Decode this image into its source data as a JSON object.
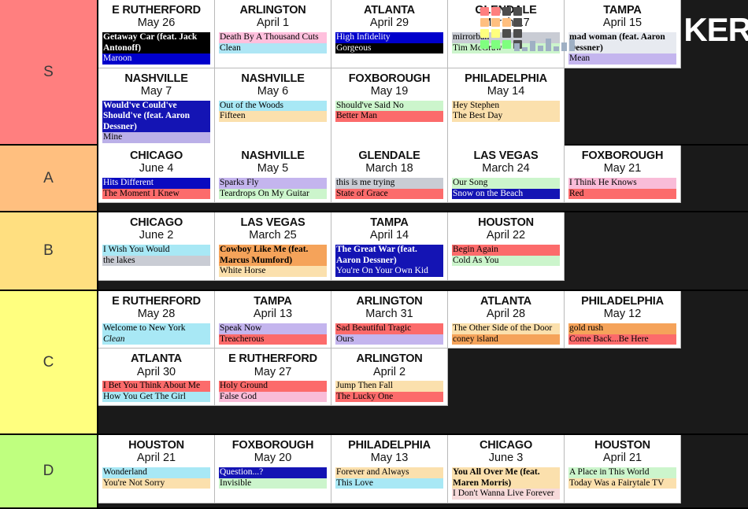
{
  "watermark": {
    "brand_text": "KER",
    "swatch_colors": [
      "#ff7f7f",
      "#ff7f7f",
      "#4d4d4d",
      "#4d4d4d",
      "#ffbf7f",
      "#ffbf7f",
      "#ffbf7f",
      "#4d4d4d",
      "#ffff7f",
      "#ffff7f",
      "#4d4d4d",
      "#4d4d4d",
      "#7fff7f",
      "#7fff7f",
      "#7fff7f",
      "#4d4d4d"
    ],
    "bar_heights": [
      10,
      5,
      13,
      7,
      16,
      6,
      11,
      15
    ]
  },
  "tiers": [
    {
      "label": "S",
      "color": "#ff7f7f",
      "cards": [
        {
          "city": "E RUTHERFORD",
          "date": "May 26",
          "songs": [
            {
              "text": "Getaway Car (feat. Jack Antonoff)",
              "bg": "#000000",
              "fg": "#ffffff",
              "bold": true
            },
            {
              "text": "Maroon",
              "bg": "#0000cc",
              "fg": "#ffffff",
              "bold": false
            }
          ]
        },
        {
          "city": "ARLINGTON",
          "date": "April 1",
          "songs": [
            {
              "text": "Death By A Thousand Cuts",
              "bg": "#ffc0dd",
              "fg": "#000000",
              "bold": false
            },
            {
              "text": "Clean",
              "bg": "#aee6f5",
              "fg": "#000000",
              "bold": false
            }
          ]
        },
        {
          "city": "ATLANTA",
          "date": "April 29",
          "songs": [
            {
              "text": "High Infidelity",
              "bg": "#0000cc",
              "fg": "#ffffff",
              "bold": false
            },
            {
              "text": "Gorgeous",
              "bg": "#000000",
              "fg": "#ffffff",
              "bold": false
            }
          ]
        },
        {
          "city": "GLENDALE",
          "date": "March 17",
          "songs": [
            {
              "text": "mirrorball",
              "bg": "#c9ccd4",
              "fg": "#000000",
              "bold": false
            },
            {
              "text": "Tim McGraw",
              "bg": "#ccf5cc",
              "fg": "#000000",
              "bold": false
            }
          ]
        },
        {
          "city": "TAMPA",
          "date": "April 15",
          "songs": [
            {
              "text": "mad woman (feat. Aaron Dessner)",
              "bg": "#e7eaf0",
              "fg": "#000000",
              "bold": true
            },
            {
              "text": "Mean",
              "bg": "#c4b5ee",
              "fg": "#000000",
              "bold": false
            }
          ]
        },
        {
          "city": "NASHVILLE",
          "date": "May 7",
          "songs": [
            {
              "text": "Would've Could've Should've (feat. Aaron Dessner)",
              "bg": "#1414b4",
              "fg": "#ffffff",
              "bold": true
            },
            {
              "text": "Mine",
              "bg": "#bbb0e8",
              "fg": "#000000",
              "bold": false
            }
          ]
        },
        {
          "city": "NASHVILLE",
          "date": "May 6",
          "songs": [
            {
              "text": "Out of the Woods",
              "bg": "#a8e8f5",
              "fg": "#000000",
              "bold": false
            },
            {
              "text": "Fifteen",
              "bg": "#fbe0ad",
              "fg": "#000000",
              "bold": false
            }
          ]
        },
        {
          "city": "FOXBOROUGH",
          "date": "May 19",
          "songs": [
            {
              "text": "Should've Said No",
              "bg": "#ccf5cc",
              "fg": "#000000",
              "bold": false
            },
            {
              "text": "Better Man",
              "bg": "#fc6b6b",
              "fg": "#000000",
              "bold": false
            }
          ]
        },
        {
          "city": "PHILADELPHIA",
          "date": "May 14",
          "songs": [
            {
              "text": "Hey Stephen",
              "bg": "#fbe0ad",
              "fg": "#000000",
              "bold": false
            },
            {
              "text": "The Best Day",
              "bg": "#fbe0ad",
              "fg": "#000000",
              "bold": false
            }
          ]
        }
      ]
    },
    {
      "label": "A",
      "color": "#ffbf7f",
      "cards": [
        {
          "city": "CHICAGO",
          "date": "June 4",
          "songs": [
            {
              "text": "Hits Different",
              "bg": "#0a0ac0",
              "fg": "#ffffff",
              "bold": false
            },
            {
              "text": "The Moment I Knew",
              "bg": "#fc6b6b",
              "fg": "#000000",
              "bold": false
            }
          ]
        },
        {
          "city": "NASHVILLE",
          "date": "May 5",
          "songs": [
            {
              "text": "Sparks Fly",
              "bg": "#c4b5ee",
              "fg": "#000000",
              "bold": false
            },
            {
              "text": "Teardrops On My Guitar",
              "bg": "#ccf5cc",
              "fg": "#000000",
              "bold": false
            }
          ]
        },
        {
          "city": "GLENDALE",
          "date": "March 18",
          "songs": [
            {
              "text": "this is me trying",
              "bg": "#c9ccd4",
              "fg": "#000000",
              "bold": false
            },
            {
              "text": "State of Grace",
              "bg": "#fc6b6b",
              "fg": "#000000",
              "bold": false
            }
          ]
        },
        {
          "city": "LAS VEGAS",
          "date": "March 24",
          "songs": [
            {
              "text": "Our Song",
              "bg": "#ccf5cc",
              "fg": "#000000",
              "bold": false
            },
            {
              "text": "Snow on the Beach",
              "bg": "#1414b4",
              "fg": "#ffffff",
              "bold": false
            }
          ]
        },
        {
          "city": "FOXBOROUGH",
          "date": "May 21",
          "songs": [
            {
              "text": "I Think He Knows",
              "bg": "#f9bcd8",
              "fg": "#000000",
              "bold": false
            },
            {
              "text": "Red",
              "bg": "#fc6b6b",
              "fg": "#000000",
              "bold": false
            }
          ]
        }
      ]
    },
    {
      "label": "B",
      "color": "#ffdf80",
      "cards": [
        {
          "city": "CHICAGO",
          "date": "June 2",
          "songs": [
            {
              "text": "I Wish You Would",
              "bg": "#a8e8f5",
              "fg": "#000000",
              "bold": false
            },
            {
              "text": "the lakes",
              "bg": "#c9ccd4",
              "fg": "#000000",
              "bold": false
            }
          ]
        },
        {
          "city": "LAS VEGAS",
          "date": "March 25",
          "songs": [
            {
              "text": "Cowboy Like Me (feat. Marcus Mumford)",
              "bg": "#f5a35a",
              "fg": "#000000",
              "bold": true
            },
            {
              "text": "White Horse",
              "bg": "#fbe0ad",
              "fg": "#000000",
              "bold": false
            }
          ]
        },
        {
          "city": "TAMPA",
          "date": "April 14",
          "songs": [
            {
              "text": "The Great War (feat. Aaron Dessner)",
              "bg": "#1414b4",
              "fg": "#ffffff",
              "bold": true
            },
            {
              "text": "You're On Your Own Kid",
              "bg": "#1414b4",
              "fg": "#ffffff",
              "bold": false
            }
          ]
        },
        {
          "city": "HOUSTON",
          "date": "April 22",
          "songs": [
            {
              "text": "Begin Again",
              "bg": "#fc6b6b",
              "fg": "#000000",
              "bold": false
            },
            {
              "text": "Cold As You",
              "bg": "#ccf5cc",
              "fg": "#000000",
              "bold": false
            }
          ]
        }
      ]
    },
    {
      "label": "C",
      "color": "#ffff7f",
      "cards": [
        {
          "city": "E RUTHERFORD",
          "date": "May 28",
          "songs": [
            {
              "text": "Welcome to New York",
              "bg": "#a8e8f5",
              "fg": "#000000",
              "bold": false
            },
            {
              "text": "Clean",
              "bg": "#a8e8f5",
              "fg": "#000000",
              "bold": false,
              "italic": true
            }
          ]
        },
        {
          "city": "TAMPA",
          "date": "April 13",
          "songs": [
            {
              "text": "Speak Now",
              "bg": "#c4b5ee",
              "fg": "#000000",
              "bold": false
            },
            {
              "text": "Treacherous",
              "bg": "#fc6b6b",
              "fg": "#000000",
              "bold": false
            }
          ]
        },
        {
          "city": "ARLINGTON",
          "date": "March 31",
          "songs": [
            {
              "text": "Sad Beautiful Tragic",
              "bg": "#fc6b6b",
              "fg": "#000000",
              "bold": false
            },
            {
              "text": "Ours",
              "bg": "#c4b5ee",
              "fg": "#000000",
              "bold": false
            }
          ]
        },
        {
          "city": "ATLANTA",
          "date": "April 28",
          "songs": [
            {
              "text": "The Other Side of the Door",
              "bg": "#fbe0ad",
              "fg": "#000000",
              "bold": false
            },
            {
              "text": "coney island",
              "bg": "#f5a35a",
              "fg": "#000000",
              "bold": false
            }
          ]
        },
        {
          "city": "PHILADELPHIA",
          "date": "May 12",
          "songs": [
            {
              "text": "gold rush",
              "bg": "#f5a35a",
              "fg": "#000000",
              "bold": false
            },
            {
              "text": "Come Back...Be Here",
              "bg": "#fc6b6b",
              "fg": "#000000",
              "bold": false
            }
          ]
        },
        {
          "city": "ATLANTA",
          "date": "April 30",
          "songs": [
            {
              "text": "I Bet You Think About Me",
              "bg": "#fc6b6b",
              "fg": "#000000",
              "bold": false
            },
            {
              "text": "How You Get The Girl",
              "bg": "#a8e8f5",
              "fg": "#000000",
              "bold": false
            }
          ]
        },
        {
          "city": "E RUTHERFORD",
          "date": "May 27",
          "songs": [
            {
              "text": "Holy Ground",
              "bg": "#fc6b6b",
              "fg": "#000000",
              "bold": false
            },
            {
              "text": "False God",
              "bg": "#f9bcd8",
              "fg": "#000000",
              "bold": false
            }
          ]
        },
        {
          "city": "ARLINGTON",
          "date": "April 2",
          "songs": [
            {
              "text": "Jump Then Fall",
              "bg": "#fbe0ad",
              "fg": "#000000",
              "bold": false
            },
            {
              "text": "The Lucky One",
              "bg": "#fc6b6b",
              "fg": "#000000",
              "bold": false
            }
          ]
        }
      ]
    },
    {
      "label": "D",
      "color": "#bfff7f",
      "cards": [
        {
          "city": "HOUSTON",
          "date": "April 21",
          "songs": [
            {
              "text": "Wonderland",
              "bg": "#a8e8f5",
              "fg": "#000000",
              "bold": false
            },
            {
              "text": "You're Not Sorry",
              "bg": "#fbe0ad",
              "fg": "#000000",
              "bold": false
            }
          ]
        },
        {
          "city": "FOXBOROUGH",
          "date": "May 20",
          "songs": [
            {
              "text": "Question...?",
              "bg": "#1414b4",
              "fg": "#ffffff",
              "bold": false
            },
            {
              "text": "Invisible",
              "bg": "#ccf5cc",
              "fg": "#000000",
              "bold": false
            }
          ]
        },
        {
          "city": "PHILADELPHIA",
          "date": "May 13",
          "songs": [
            {
              "text": "Forever and Always",
              "bg": "#fbe0ad",
              "fg": "#000000",
              "bold": false
            },
            {
              "text": "This Love",
              "bg": "#a8e8f5",
              "fg": "#000000",
              "bold": false
            }
          ]
        },
        {
          "city": "CHICAGO",
          "date": "June 3",
          "songs": [
            {
              "text": "You All Over Me (feat. Maren Morris)",
              "bg": "#fbe0ad",
              "fg": "#000000",
              "bold": true
            },
            {
              "text": "I Don't Wanna Live Forever",
              "bg": "#f7dada",
              "fg": "#000000",
              "bold": false
            }
          ]
        },
        {
          "city": "HOUSTON",
          "date": "April 21",
          "songs": [
            {
              "text": "A Place in This World",
              "bg": "#ccf5cc",
              "fg": "#000000",
              "bold": false
            },
            {
              "text": "Today Was a Fairytale TV",
              "bg": "#fbe0ad",
              "fg": "#000000",
              "bold": false
            }
          ]
        }
      ]
    }
  ]
}
